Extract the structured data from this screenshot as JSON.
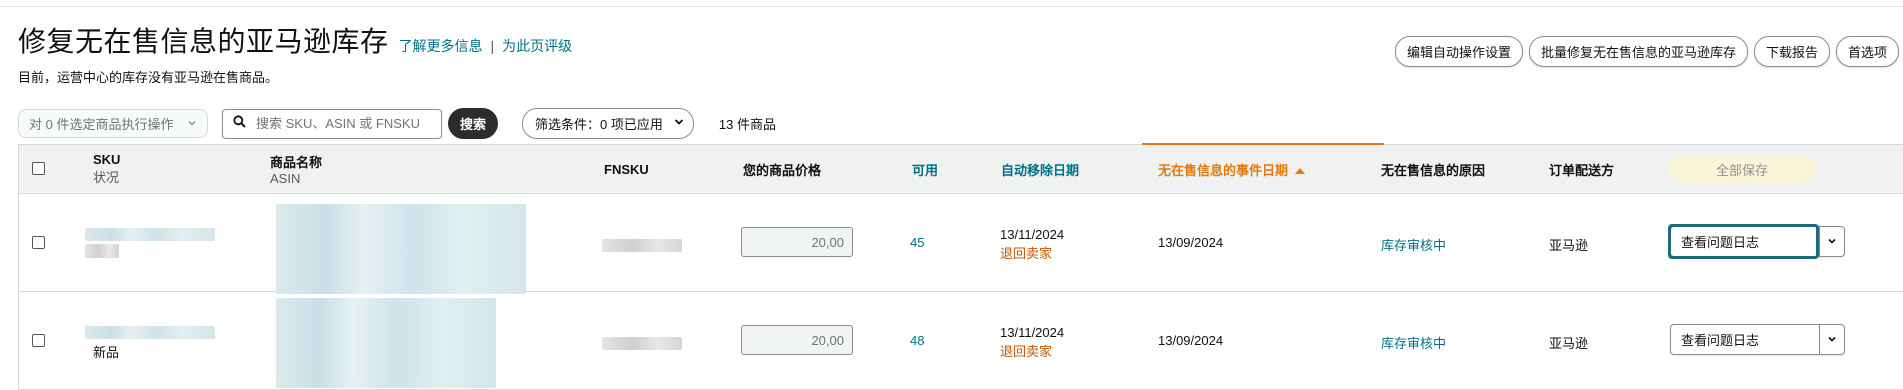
{
  "header": {
    "title": "修复无在售信息的亚马逊库存",
    "learn_more": "了解更多信息",
    "separator": "|",
    "rate_page": "为此页评级",
    "subtitle": "目前，运营中心的库存没有亚马逊在售商品。"
  },
  "top_actions": {
    "auto_settings": "编辑自动操作设置",
    "bulk_fix": "批量修复无在售信息的亚马逊库存",
    "download": "下载报告",
    "preferences": "首选项"
  },
  "toolbar": {
    "bulk_action": "对 0 件选定商品执行操作",
    "search_placeholder": "搜索 SKU、ASIN 或 FNSKU",
    "search_button": "搜索",
    "filter_label": "筛选条件：",
    "filter_value": "0 项已应用",
    "item_count": "13 件商品"
  },
  "table": {
    "headers": {
      "sku": "SKU",
      "status": "状况",
      "product_name": "商品名称",
      "asin": "ASIN",
      "fnsku": "FNSKU",
      "price": "您的商品价格",
      "available": "可用",
      "auto_removal": "自动移除日期",
      "event_date": "无在售信息的事件日期",
      "reason": "无在售信息的原因",
      "fulfillment": "订单配送方",
      "save_all": "全部保存"
    },
    "rows": [
      {
        "condition": "",
        "price": "20,00",
        "available": "45",
        "removal_date": "13/11/2024",
        "removal_action": "退回卖家",
        "event_date": "13/09/2024",
        "reason": "库存审核中",
        "fulfillment": "亚马逊",
        "action": "查看问题日志"
      },
      {
        "condition": "新品",
        "price": "20,00",
        "available": "48",
        "removal_date": "13/11/2024",
        "removal_action": "退回卖家",
        "event_date": "13/09/2024",
        "reason": "库存审核中",
        "fulfillment": "亚马逊",
        "action": "查看问题日志"
      }
    ]
  },
  "icons": {
    "search": "search-icon",
    "chevron": "chevron-down-icon",
    "sort": "sort-ascending-icon"
  },
  "colors": {
    "link": "#007185",
    "sort_accent": "#e47911",
    "removal_action": "#c45500",
    "focus_ring": "#1b6b7a",
    "save_all_bg": "#fcf4d6"
  }
}
